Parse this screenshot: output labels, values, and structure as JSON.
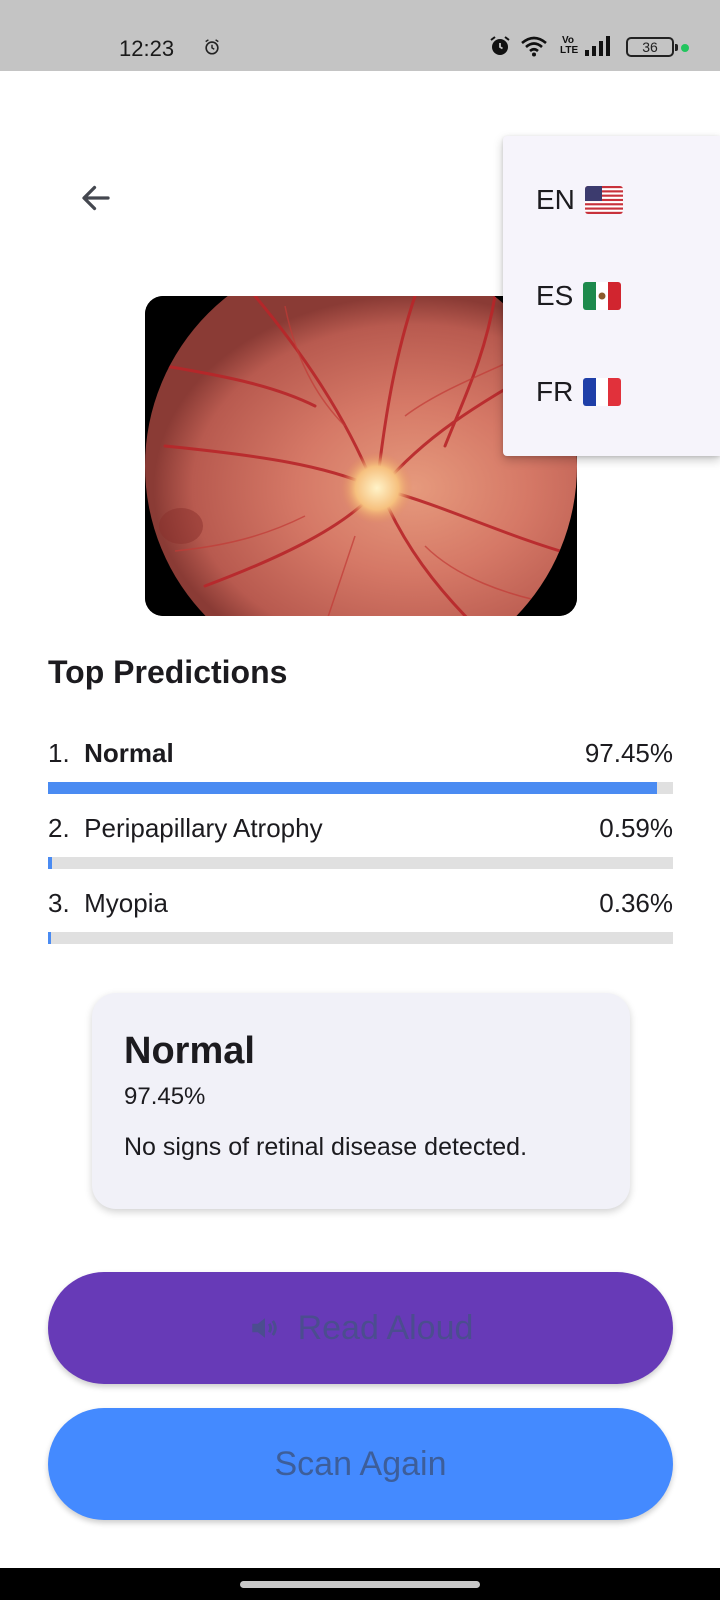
{
  "status_bar": {
    "time": "12:23",
    "battery": "36",
    "network": "Vo LTE",
    "icons": [
      "alarm-icon",
      "wifi-icon",
      "volte-icon",
      "signal-icon",
      "battery-icon"
    ]
  },
  "nav": {
    "back_icon": "arrow-left-icon"
  },
  "language_menu": {
    "items": [
      {
        "code": "EN",
        "flag": "flag-us-icon"
      },
      {
        "code": "ES",
        "flag": "flag-mx-icon"
      },
      {
        "code": "FR",
        "flag": "flag-fr-icon"
      }
    ]
  },
  "predictions": {
    "title": "Top Predictions",
    "items": [
      {
        "rank": "1.",
        "label": "Normal",
        "percent": "97.45%",
        "value": 0.9745
      },
      {
        "rank": "2.",
        "label": "Peripapillary Atrophy",
        "percent": "0.59%",
        "value": 0.0059
      },
      {
        "rank": "3.",
        "label": "Myopia",
        "percent": "0.36%",
        "value": 0.0036
      }
    ]
  },
  "result": {
    "label": "Normal",
    "percent": "97.45%",
    "description": "No signs of retinal disease detected."
  },
  "buttons": {
    "read_aloud": "Read Aloud",
    "scan_again": "Scan Again"
  },
  "colors": {
    "accent_blue": "#448aff",
    "accent_purple": "#673ab7",
    "progress_fill": "#4a8bf2"
  }
}
